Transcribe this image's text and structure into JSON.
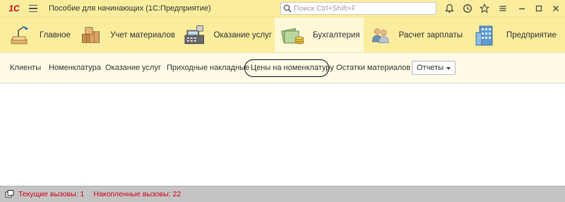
{
  "titlebar": {
    "logo_text": "1С",
    "app_title": "Пособие для начинающих  (1С:Предприятие)",
    "search_placeholder": "Поиск Ctrl+Shift+F",
    "icons": [
      "menu-icon",
      "search-icon",
      "bell-icon",
      "history-icon",
      "star-icon",
      "more-icon",
      "minimize-icon",
      "maximize-icon",
      "close-icon"
    ]
  },
  "sections": {
    "items": [
      {
        "label": "Главное",
        "icon": "main-section-icon"
      },
      {
        "label": "Учет материалов",
        "icon": "materials-section-icon"
      },
      {
        "label": "Оказание услуг",
        "icon": "services-section-icon"
      },
      {
        "label": "Бухгалтерия",
        "icon": "accounting-section-icon",
        "active": true
      },
      {
        "label": "Расчет зарплаты",
        "icon": "payroll-section-icon"
      },
      {
        "label": "Предприятие",
        "icon": "enterprise-section-icon"
      }
    ]
  },
  "commands": {
    "items": [
      {
        "label": "Клиенты"
      },
      {
        "label": "Номенклатура"
      },
      {
        "label": "Оказание услуг"
      },
      {
        "label": "Приходные накладные"
      },
      {
        "label": "Цены на номенклатуру",
        "circled": true
      },
      {
        "label": "Остатки материалов"
      }
    ],
    "reports_label": "Отчеты"
  },
  "statusbar": {
    "current_calls": "Текущие вызовы: 1",
    "accumulated_calls": "Накопленные вызовы: 22",
    "text_color": "#d0021b"
  },
  "colors": {
    "panel_yellow": "#fbed9e",
    "active_section": "#fff9d8",
    "commands_bg": "#fffbe6",
    "status_gray": "#c4c4c4"
  }
}
